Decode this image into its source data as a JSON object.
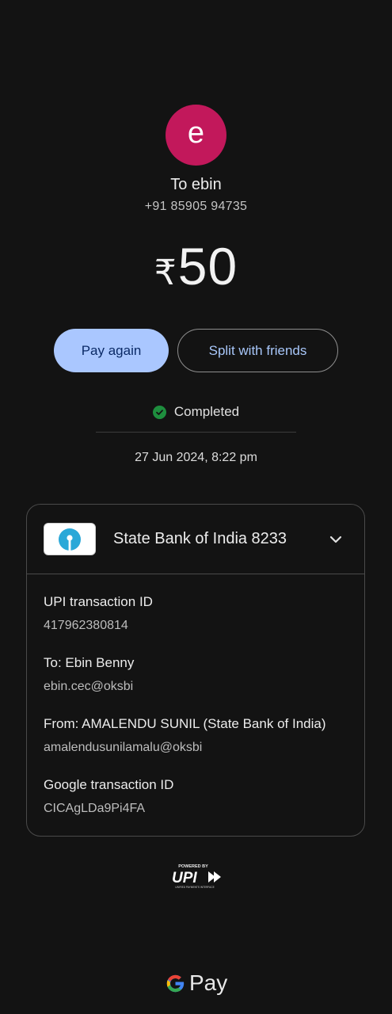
{
  "recipient": {
    "avatar_letter": "e",
    "avatar_color": "#c2185b",
    "name": "To ebin",
    "phone": "+91 85905 94735"
  },
  "amount": {
    "currency_symbol": "₹",
    "value": "50"
  },
  "actions": {
    "pay_again_label": "Pay again",
    "split_label": "Split with friends"
  },
  "status": {
    "icon": "check-circle-icon",
    "label": "Completed",
    "color": "#1e8e3e"
  },
  "datetime": "27 Jun 2024, 8:22 pm",
  "bank_card": {
    "bank_name": "State Bank of India 8233",
    "logo_icon": "sbi-logo-icon",
    "expand_icon": "chevron-down-icon",
    "details": [
      {
        "label": "UPI transaction ID",
        "value": "417962380814"
      },
      {
        "label": "To: Ebin  Benny",
        "value": "ebin.cec@oksbi"
      },
      {
        "label": "From: AMALENDU  SUNIL (State Bank of India)",
        "value": "amalendusunilamalu@oksbi"
      },
      {
        "label": "Google transaction ID",
        "value": "CICAgLDa9Pi4FA"
      }
    ]
  },
  "footer": {
    "upi_logo": {
      "powered_by": "POWERED BY",
      "mark": "UPI",
      "tagline": "UNIFIED PAYMENTS INTERFACE"
    },
    "gpay_label": "Pay"
  }
}
